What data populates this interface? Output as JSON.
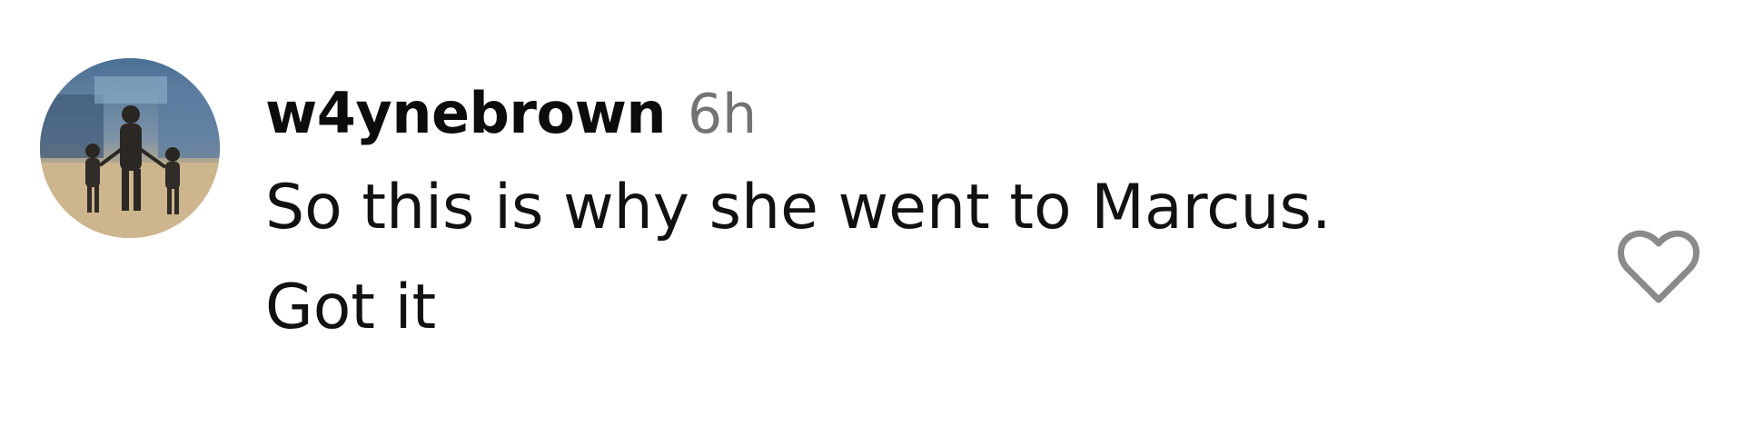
{
  "comment": {
    "username": "w4ynebrown",
    "timestamp": "6h",
    "text_line1": "So this is why she went to Marcus.",
    "text_line2": "Got it"
  },
  "icons": {
    "like": "heart-icon"
  },
  "colors": {
    "text": "#111111",
    "timestamp": "#737373",
    "icon_stroke": "#8a8a8a",
    "background": "#ffffff"
  }
}
